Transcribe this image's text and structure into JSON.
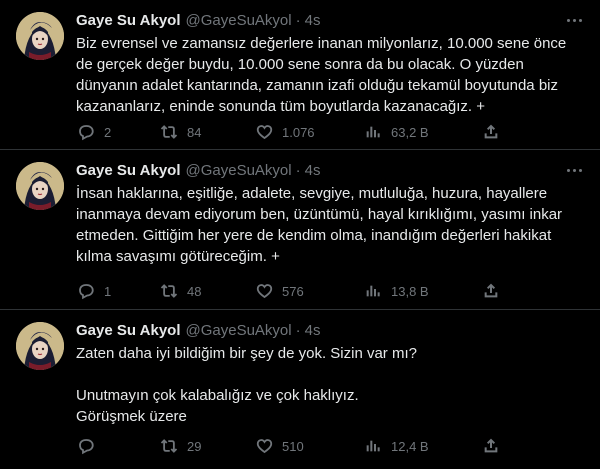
{
  "tweets": [
    {
      "author_name": "Gaye Su Akyol",
      "handle": "@GayeSuAkyol",
      "separator": "·",
      "time": "4s",
      "text": "Biz evrensel ve zamansız değerlere inanan milyonlarız, 10.000 sene önce\nde gerçek değer buydu, 10.000 sene sonra da bu olacak. O yüzden\ndünyanın adalet kantarında, zamanın izafi olduğu tekamül boyutunda biz\nkazananlarız, eninde sonunda tüm boyutlarda kazanacağız. +",
      "replies": "2",
      "retweets": "84",
      "likes": "1.076",
      "views": "63,2 B"
    },
    {
      "author_name": "Gaye Su Akyol",
      "handle": "@GayeSuAkyol",
      "separator": "·",
      "time": "4s",
      "text": "İnsan haklarına, eşitliğe, adalete, sevgiye, mutluluğa, huzura, hayallere\ninanmaya devam ediyorum ben, üzüntümü, hayal kırıklığımı, yasımı inkar\netmeden. Gittiğim her yere de kendim olma, inandığım değerleri hakikat\nkılma savaşımı götüreceğim. +",
      "replies": "1",
      "retweets": "48",
      "likes": "576",
      "views": "13,8 B"
    },
    {
      "author_name": "Gaye Su Akyol",
      "handle": "@GayeSuAkyol",
      "separator": "·",
      "time": "4s",
      "text": "Zaten daha iyi bildiğim bir şey de yok. Sizin var mı?\n\nUnutmayın çok kalabalığız ve çok haklıyız.\nGörüşmek üzere",
      "replies": "",
      "retweets": "29",
      "likes": "510",
      "views": "12,4 B"
    }
  ],
  "icons": {
    "reply": "reply-icon",
    "retweet": "retweet-icon",
    "like": "heart-icon",
    "views": "views-chart-icon",
    "share": "share-icon",
    "more": "more-options-icon"
  },
  "colors": {
    "background": "#000000",
    "text": "#e7e9ea",
    "muted": "#71767b",
    "divider": "#2f3336"
  }
}
